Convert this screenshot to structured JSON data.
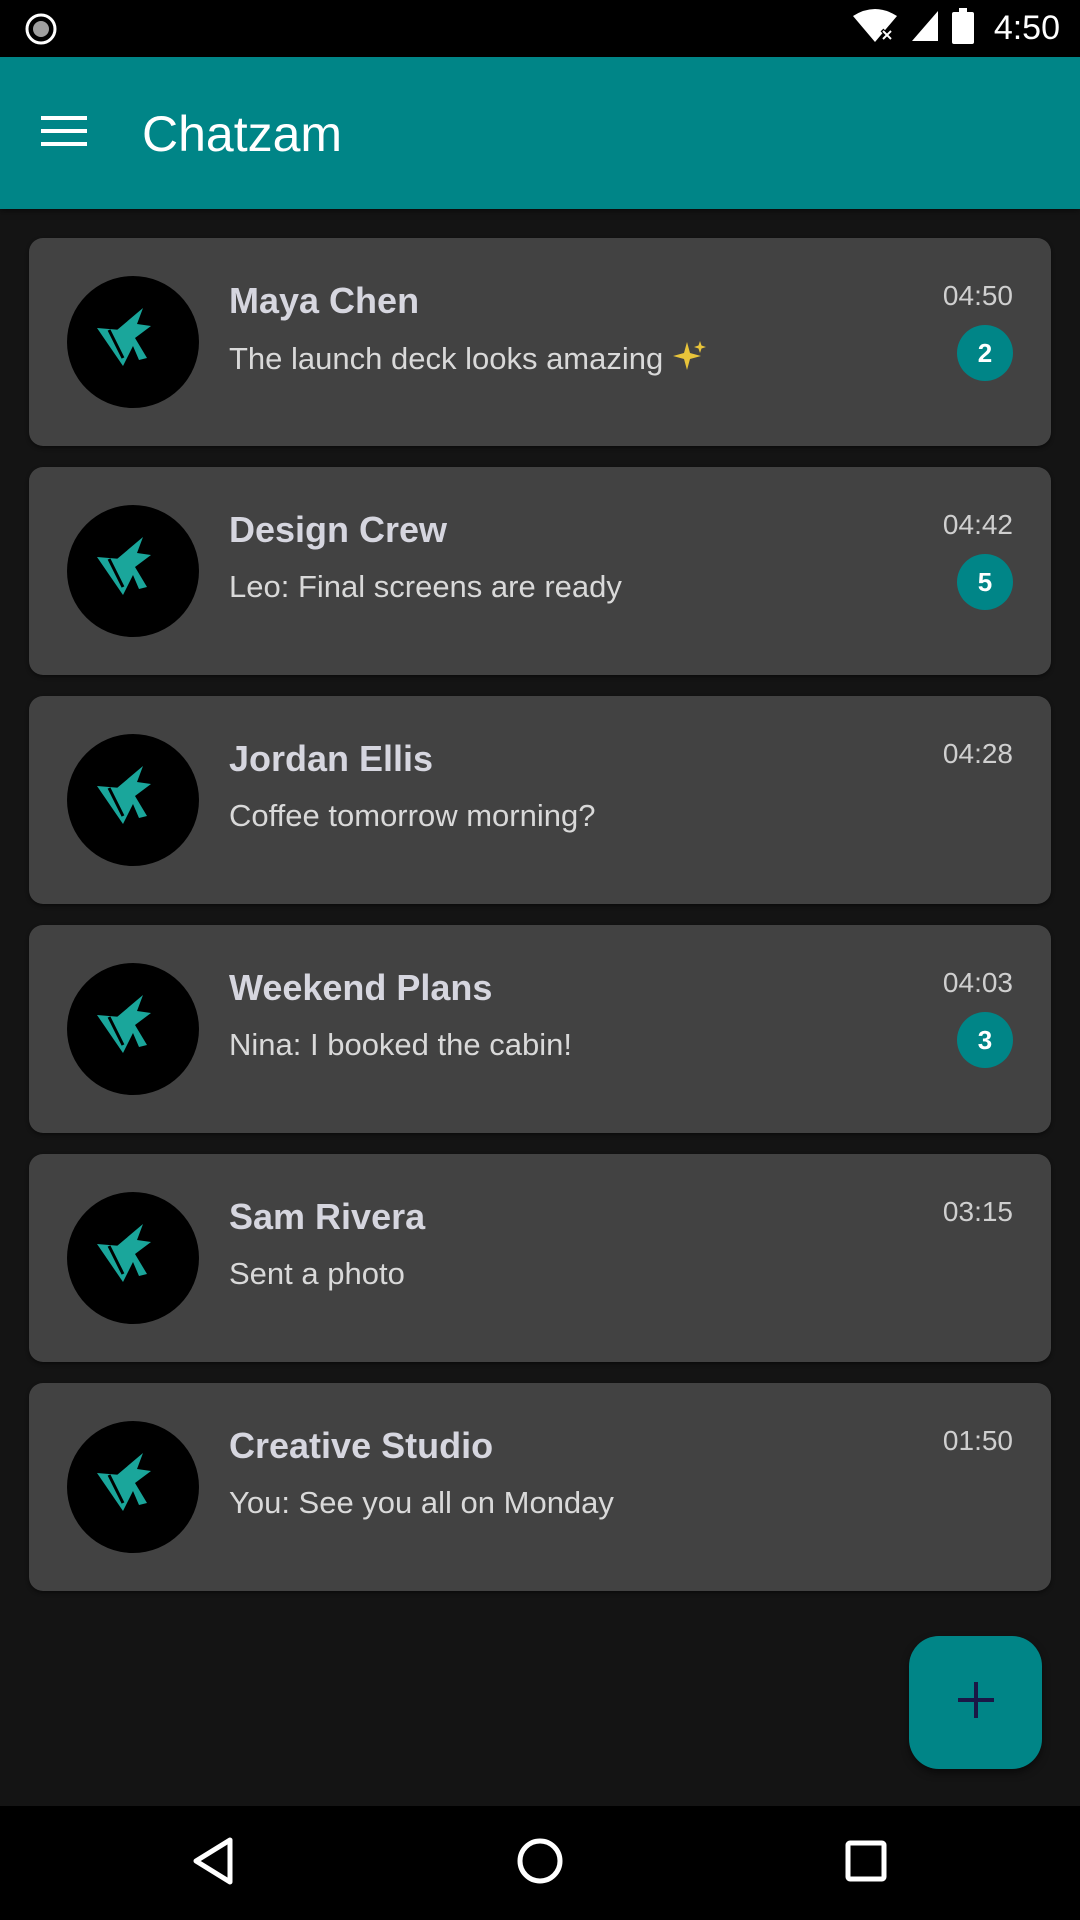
{
  "status_bar": {
    "time": "4:50",
    "icons": [
      "record-icon",
      "wifi-icon",
      "signal-icon",
      "battery-icon"
    ]
  },
  "app_bar": {
    "title": "Chatzam",
    "menu_icon": "hamburger-menu-icon"
  },
  "colors": {
    "accent": "#008587",
    "card": "#424242",
    "background": "#141414",
    "avatar_logo": "#1aa69b"
  },
  "chats": [
    {
      "name": "Maya Chen",
      "preview": "The launch deck looks amazing",
      "time": "04:50",
      "unread": "2",
      "has_sparkle": true
    },
    {
      "name": "Design Crew",
      "preview": "Leo: Final screens are ready",
      "time": "04:42",
      "unread": "5"
    },
    {
      "name": "Jordan Ellis",
      "preview": "Coffee tomorrow morning?",
      "time": "04:28"
    },
    {
      "name": "Weekend Plans",
      "preview": "Nina: I booked the cabin!",
      "time": "04:03",
      "unread": "3"
    },
    {
      "name": "Sam Rivera",
      "preview": "Sent a photo",
      "time": "03:15"
    },
    {
      "name": "Creative Studio",
      "preview": "You: See you all on Monday",
      "time": "01:50"
    }
  ],
  "fab": {
    "icon": "plus-icon"
  },
  "nav_bar": {
    "icons": [
      "back-icon",
      "home-icon",
      "recents-icon"
    ]
  }
}
